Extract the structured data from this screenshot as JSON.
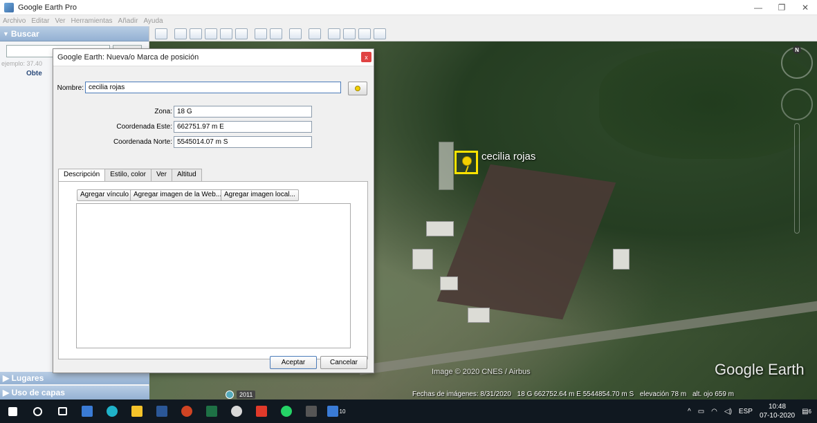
{
  "window": {
    "title": "Google Earth Pro",
    "controls": [
      "—",
      "❐",
      "✕"
    ]
  },
  "menu": [
    "Archivo",
    "Editar",
    "Ver",
    "Herramientas",
    "Añadir",
    "Ayuda"
  ],
  "sidebar": {
    "search_header": "Buscar",
    "search_hint": "ejemplo: 37.40",
    "obte_label": "Obte",
    "places_header": "Lugares",
    "layers_header": "Uso de capas"
  },
  "dialog": {
    "title": "Google Earth: Nueva/o Marca de posición",
    "close": "x",
    "name_label": "Nombre:",
    "name_value": "cecilia rojas",
    "zona_label": "Zona:",
    "zona_value": "18 G",
    "este_label": "Coordenada Este:",
    "este_value": "662751.97 m E",
    "norte_label": "Coordenada Norte:",
    "norte_value": "5545014.07 m S",
    "tabs": [
      "Descripción",
      "Estilo, color",
      "Ver",
      "Altitud"
    ],
    "btn_link": "Agregar vínculo",
    "btn_web_image": "Agregar imagen de la Web...",
    "btn_local_image": "Agregar imagen local...",
    "accept": "Aceptar",
    "cancel": "Cancelar"
  },
  "map": {
    "placemark_label": "cecilia rojas",
    "north_badge": "N",
    "copyright": "Image © 2020 CNES / Airbus",
    "watermark": "Google Earth",
    "year": "2011",
    "status": {
      "imagery_date": "Fechas de imágenes: 8/31/2020",
      "coords": "18 G 662752.64 m E 5544854.70 m S",
      "elevation": "elevación   78 m",
      "eye_alt": "alt. ojo   659 m"
    }
  },
  "taskbar": {
    "lang": "ESP",
    "time": "10:48",
    "date": "07-10-2020",
    "badge_count": "10",
    "notif_count": "6"
  },
  "colors": {
    "panel_header": "#94b1d3",
    "placemark": "#ffe400",
    "close_red": "#e04343",
    "taskbar": "#101820"
  }
}
